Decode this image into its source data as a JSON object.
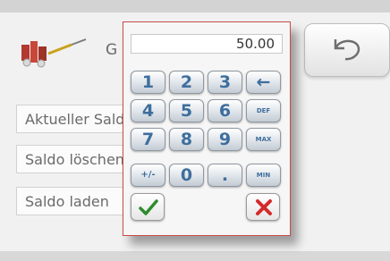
{
  "header": {
    "app_letter": "G"
  },
  "menu": {
    "items": [
      {
        "label": "Aktueller Saldo"
      },
      {
        "label": "Saldo löschen"
      },
      {
        "label": "Saldo laden"
      }
    ]
  },
  "keypad": {
    "display_value": "50.00",
    "keys": [
      "1",
      "2",
      "3",
      "←",
      "4",
      "5",
      "6",
      "DEF",
      "7",
      "8",
      "9",
      "MAX",
      "+/-",
      "0",
      ".",
      "MIN"
    ]
  },
  "colors": {
    "border_accent": "#c94a4a",
    "key_text": "#3e6e9d",
    "ok": "#2e8b2e",
    "cancel": "#d42a2a"
  },
  "icons": {
    "logo": "component-logo-icon",
    "back": "undo-back-icon",
    "ok": "checkmark-icon",
    "cancel": "cross-icon"
  }
}
